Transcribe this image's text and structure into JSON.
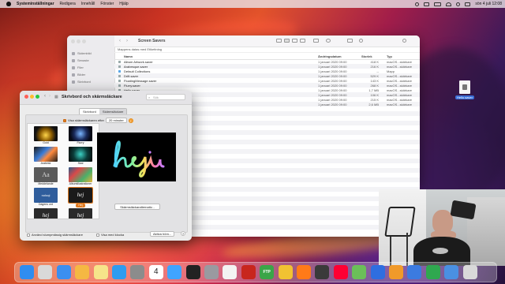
{
  "menubar": {
    "app_name": "Systeminställningar",
    "items": [
      "Redigera",
      "Innehåll",
      "Fönster",
      "Hjälp"
    ],
    "clock": "sön 4 juli 12:08"
  },
  "finder": {
    "title": "Screen Savers",
    "path": "Mappens datas med Etikettning",
    "columns": {
      "name": "Namn",
      "date": "Ändringsdatum",
      "size": "Storlek",
      "kind": "Typ"
    },
    "sidebar": [
      "Skärmbild",
      "Senaste",
      "Filer",
      "Bilder",
      "Skrivbord"
    ],
    "files": [
      {
        "name": "Album Artwork.saver",
        "date": "1 januari 2020 09:00",
        "size": "418 K",
        "kind": "macOS...skärkare",
        "folder": false
      },
      {
        "name": "Arabesque.saver",
        "date": "1 januari 2020 09:00",
        "size": "216 K",
        "kind": "macOS...skärkare",
        "folder": false
      },
      {
        "name": "Default Collections",
        "date": "1 januari 2020 09:00",
        "size": "--",
        "kind": "Mapp",
        "folder": true
      },
      {
        "name": "Drift.saver",
        "date": "1 januari 2020 09:00",
        "size": "529 K",
        "kind": "macOS...skärkare",
        "folder": false
      },
      {
        "name": "FloatingMessage.saver",
        "date": "1 januari 2020 09:00",
        "size": "143 K",
        "kind": "macOS...skärkare",
        "folder": false
      },
      {
        "name": "Flurry.saver",
        "date": "1 januari 2020 09:00",
        "size": "268 K",
        "kind": "macOS...skärkare",
        "folder": false
      },
      {
        "name": "Hello.saver",
        "date": "1 januari 2020 09:00",
        "size": "1,7 MB",
        "kind": "macOS...skärkare",
        "folder": false
      },
      {
        "name": "iLifeSlideshows.saver",
        "date": "1 januari 2020 09:00",
        "size": "106 K",
        "kind": "macOS...skärkare",
        "folder": false
      },
      {
        "name": "Random.saver",
        "date": "1 januari 2020 09:00",
        "size": "215 K",
        "kind": "macOS...skärkare",
        "folder": false
      },
      {
        "name": "Shell.saver",
        "date": "1 januari 2020 09:00",
        "size": "2,6 MB",
        "kind": "macOS...skärkare",
        "folder": false
      }
    ]
  },
  "prefs": {
    "title": "Skrivbord och skärmsläckare",
    "search_placeholder": "Sök",
    "tabs": [
      "Skrivbord",
      "Skärmsläckare"
    ],
    "active_tab": "Skärmsläckare",
    "show_after_label": "Visa skärmsläckaren efter",
    "show_after_value": "20 minuter",
    "savers": [
      {
        "label": "Gold"
      },
      {
        "label": "Flurry"
      },
      {
        "label": "Arabesk"
      },
      {
        "label": "Skal"
      },
      {
        "label": "Meddelande"
      },
      {
        "label": "Albumillustrationer"
      },
      {
        "label": "Dagens ord"
      },
      {
        "label": "Hej"
      },
      {
        "label": "Hej"
      },
      {
        "label": "Hej"
      }
    ],
    "preview_text": "hej",
    "options_button": "Skärmsläckaralternativ...",
    "random_checkbox": "Använd slumpmässig skärmsläckare",
    "clock_checkbox": "Visa med klocka",
    "hot_corners": "Aktiva hörn...",
    "help": "?"
  },
  "desktop_file": {
    "label": "Hello.saver"
  },
  "dock": {
    "icons": [
      "finder-icon",
      "launchpad-icon",
      "mail-icon",
      "photos-icon",
      "notes-icon",
      "appstore-icon",
      "systemprefs-icon",
      "calendar-icon",
      "safari-icon",
      "terminal-icon",
      "diskutility-icon",
      "textedit-icon",
      "filezilla-icon",
      "ftp-icon",
      "chrome-icon",
      "firefox-icon",
      "movie-icon",
      "youtube-icon",
      "maps-icon",
      "xcode-icon",
      "pages-icon",
      "keynote-icon",
      "numbers-icon",
      "downloads-icon",
      "trash-icon"
    ],
    "calendar_day": "4"
  }
}
